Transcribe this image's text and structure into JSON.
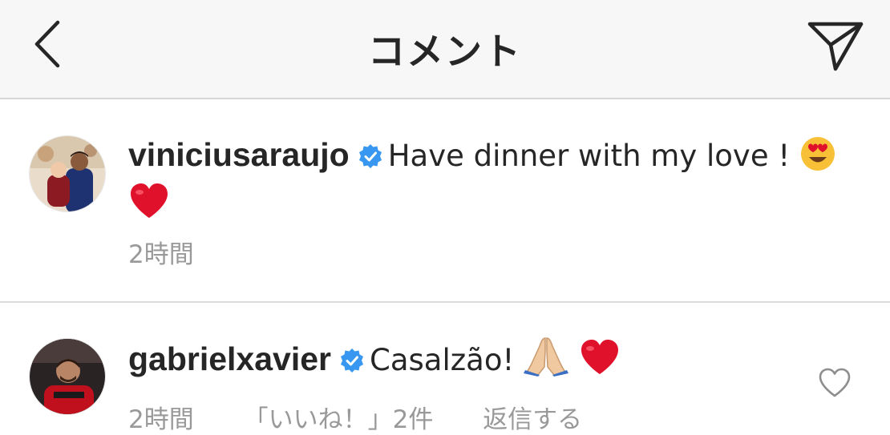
{
  "header": {
    "title": "コメント",
    "back_icon": "chevron-left-icon",
    "send_icon": "paper-plane-icon"
  },
  "comments": [
    {
      "username": "viniciusaraujo",
      "verified": true,
      "text": "Have dinner with my love ! 😍 ❤️",
      "text_main": "Have dinner with my love !",
      "time": "2時間"
    },
    {
      "username": "gabrielxavier",
      "verified": true,
      "text": "Casalzão! 🙏🏼 ❤️",
      "text_main": "Casalzão!",
      "time": "2時間",
      "likes": "「いいね！」2件",
      "reply": "返信する"
    }
  ],
  "colors": {
    "verified_badge": "#3897f0",
    "heart": "#e0112b",
    "meta_gray": "#999999",
    "header_bg": "#f7f7f7"
  }
}
